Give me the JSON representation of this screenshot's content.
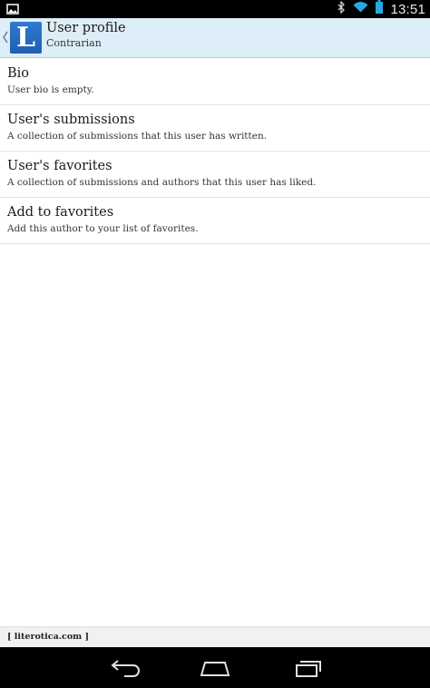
{
  "status_bar": {
    "time": "13:51",
    "icons": [
      "gallery-notification-icon",
      "bluetooth-icon",
      "wifi-icon",
      "battery-icon"
    ]
  },
  "action_bar": {
    "title": "User profile",
    "subtitle": "Contrarian",
    "logo_letter": "L",
    "accent_color": "#ddeef8",
    "logo_color": "#2a6fc6"
  },
  "list": {
    "items": [
      {
        "title": "Bio",
        "description": "User bio is empty."
      },
      {
        "title": "User's submissions",
        "description": "A collection of submissions that this user has written."
      },
      {
        "title": "User's favorites",
        "description": "A collection of submissions and authors that this user has liked."
      },
      {
        "title": "Add to favorites",
        "description": "Add this author to your list of favorites."
      }
    ]
  },
  "footer": {
    "label": "[ literotica.com ]"
  },
  "nav_bar": {
    "buttons": [
      "back-icon",
      "home-icon",
      "recent-apps-icon"
    ]
  }
}
